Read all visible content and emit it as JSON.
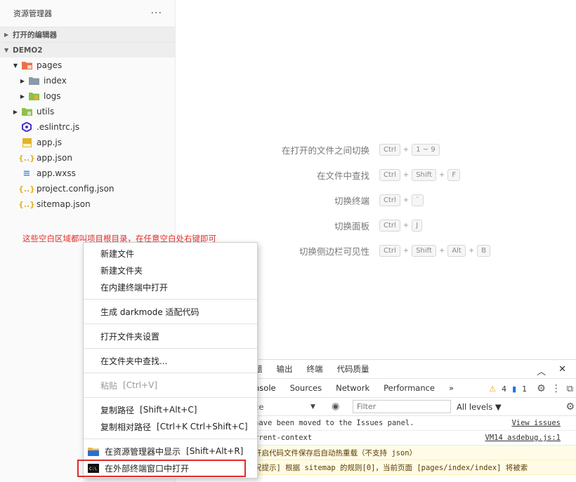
{
  "sidebar": {
    "title": "资源管理器",
    "more": "···",
    "open_editors": "打开的编辑器",
    "project": "DEMO2",
    "tree": [
      {
        "label": "pages",
        "depth": 1,
        "twist": "▼",
        "icon": "folder-pages-icon"
      },
      {
        "label": "index",
        "depth": 2,
        "twist": "▶",
        "icon": "folder-icon"
      },
      {
        "label": "logs",
        "depth": 2,
        "twist": "▶",
        "icon": "folder-logs-icon"
      },
      {
        "label": "utils",
        "depth": 1,
        "twist": "▶",
        "icon": "folder-utils-icon"
      },
      {
        "label": ".eslintrc.js",
        "depth": 1,
        "twist": "",
        "icon": "eslint-icon"
      },
      {
        "label": "app.js",
        "depth": 1,
        "twist": "",
        "icon": "js-file-icon"
      },
      {
        "label": "app.json",
        "depth": 1,
        "twist": "",
        "icon": "json-file-icon"
      },
      {
        "label": "app.wxss",
        "depth": 1,
        "twist": "",
        "icon": "wxss-file-icon"
      },
      {
        "label": "project.config.json",
        "depth": 1,
        "twist": "",
        "icon": "json-file-icon"
      },
      {
        "label": "sitemap.json",
        "depth": 1,
        "twist": "",
        "icon": "json-file-icon"
      }
    ],
    "annotation": "这些空白区域都叫项目根目录，在任意空白处右键即可"
  },
  "shortcuts": [
    {
      "label": "在打开的文件之间切换",
      "keys": [
        "Ctrl",
        "1 ~ 9"
      ]
    },
    {
      "label": "在文件中查找",
      "keys": [
        "Ctrl",
        "Shift",
        "F"
      ]
    },
    {
      "label": "切换终端",
      "keys": [
        "Ctrl",
        "`"
      ]
    },
    {
      "label": "切换面板",
      "keys": [
        "Ctrl",
        "J"
      ]
    },
    {
      "label": "切换侧边栏可见性",
      "keys": [
        "Ctrl",
        "Shift",
        "Alt",
        "B"
      ]
    }
  ],
  "panel": {
    "tabs": [
      "题",
      "输出",
      "终端",
      "代码质量"
    ],
    "devtools_tabs": [
      "nsole",
      "Sources",
      "Network",
      "Performance",
      "»"
    ],
    "warn_count": "4",
    "msg_count": "1",
    "context_select": "ce",
    "filter_placeholder": "Filter",
    "levels": "All levels ▼",
    "logs": [
      {
        "msg": "have been moved to the Issues panel.",
        "src": "View issues",
        "warn": false
      },
      {
        "msg": "rrent-context",
        "src": "VM14 asdebug.js:1",
        "warn": false
      },
      {
        "msg": "开启代码文件保存后自动热重载（不支持 json）",
        "src": "",
        "warn": true
      },
      {
        "msg": "况提示] 根据 sitemap 的规则[0]，当前页面 [pages/index/index] 将被索",
        "src": "",
        "warn": true
      }
    ]
  },
  "context_menu": {
    "groups": [
      [
        {
          "label": "新建文件"
        },
        {
          "label": "新建文件夹"
        },
        {
          "label": "在内建终端中打开"
        }
      ],
      [
        {
          "label": "生成 darkmode 适配代码"
        }
      ],
      [
        {
          "label": "打开文件夹设置"
        }
      ],
      [
        {
          "label": "在文件夹中查找..."
        }
      ],
      [
        {
          "label": "粘贴",
          "shortcut": "[Ctrl+V]",
          "disabled": true
        }
      ],
      [
        {
          "label": "复制路径",
          "shortcut": "[Shift+Alt+C]"
        },
        {
          "label": "复制相对路径",
          "shortcut": "[Ctrl+K Ctrl+Shift+C]"
        }
      ],
      [
        {
          "label": "在资源管理器中显示",
          "shortcut": "[Shift+Alt+R]",
          "icon": "explorer-folder-icon"
        },
        {
          "label": "在外部终端窗口中打开",
          "icon": "terminal-icon"
        }
      ]
    ]
  },
  "colors": {
    "annotation": "#e0302d",
    "highlight": "#e02a2a",
    "folder": "#8a9aa9",
    "folder_pages": "#e8714a",
    "folder_green": "#8dc149",
    "json": "#e3b22a",
    "wxss": "#3a8be8",
    "eslint": "#4b32c3"
  }
}
